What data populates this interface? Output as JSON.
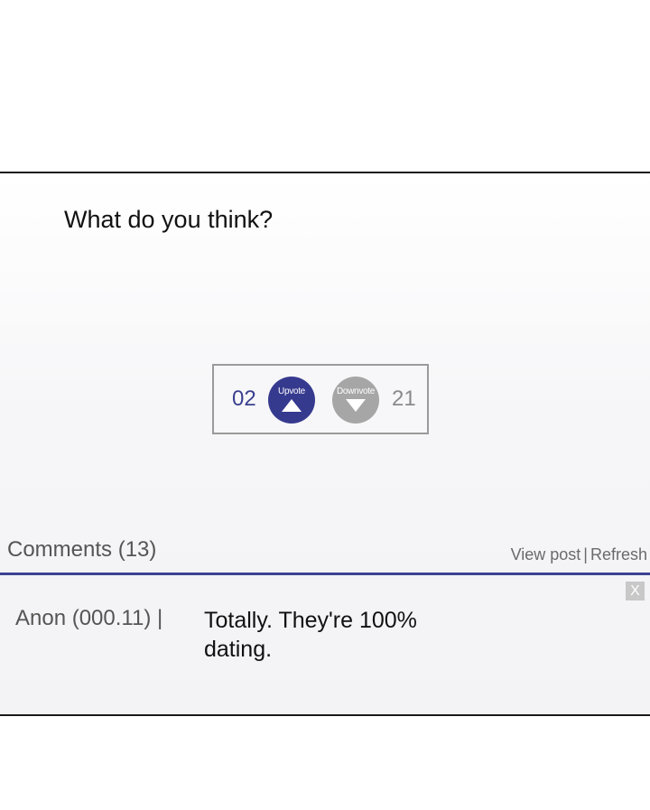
{
  "question": "What do you think?",
  "votes": {
    "up_count": "02",
    "up_label": "Upvote",
    "down_label": "Downvote",
    "down_count": "21"
  },
  "comments": {
    "title": "Comments (13)",
    "view_post": "View post",
    "separator": "|",
    "refresh": "Refresh",
    "close_label": "X",
    "items": [
      {
        "author": "Anon (000.11) |",
        "text": "Totally. They're 100% dating."
      }
    ]
  },
  "colors": {
    "accent": "#363a8f",
    "downvote": "#a6a6a6",
    "divider": "#3c4391"
  }
}
